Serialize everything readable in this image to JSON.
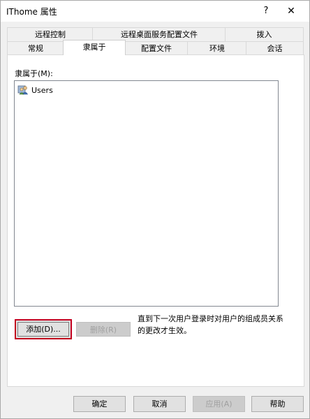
{
  "window": {
    "title": "IThome 属性",
    "help_glyph": "?",
    "close_glyph": "✕"
  },
  "tabs_row1": [
    {
      "label": "远程控制"
    },
    {
      "label": "远程桌面服务配置文件"
    },
    {
      "label": "拨入"
    }
  ],
  "tabs_row2": [
    {
      "label": "常规"
    },
    {
      "label": "隶属于"
    },
    {
      "label": "配置文件"
    },
    {
      "label": "环境"
    },
    {
      "label": "会话"
    }
  ],
  "panel": {
    "members_label": "隶属于(M):",
    "members": [
      {
        "name": "Users",
        "icon": "group-icon"
      }
    ],
    "add_button": "添加(D)...",
    "remove_button": "删除(R)",
    "note": "直到下一次用户登录时对用户的组成员关系的更改才生效。"
  },
  "footer": {
    "ok": "确定",
    "cancel": "取消",
    "apply": "应用(A)",
    "help": "帮助"
  },
  "colors": {
    "highlight_border": "#c3001f",
    "window_bg": "#f0f0f0"
  }
}
